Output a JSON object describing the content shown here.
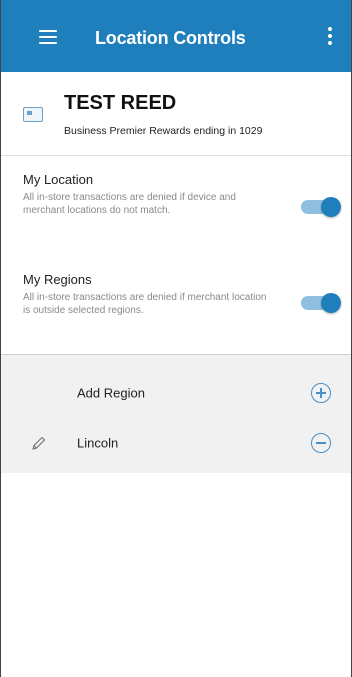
{
  "appbar": {
    "title": "Location Controls"
  },
  "card": {
    "name": "TEST REED",
    "description": "Business Premier Rewards ending in 1029"
  },
  "settings": {
    "my_location": {
      "title": "My Location",
      "description": "All in-store transactions are denied if device and merchant locations do not match.",
      "enabled": true
    },
    "my_regions": {
      "title": "My Regions",
      "description": "All in-store transactions are denied if merchant location is outside selected regions.",
      "enabled": true
    }
  },
  "regions": {
    "add_label": "Add Region",
    "items": [
      {
        "name": "Lincoln"
      }
    ]
  },
  "colors": {
    "primary": "#1f7fbd",
    "toggle_track": "#8fbfe0",
    "region_bg": "#f1f1f1",
    "muted_text": "#8a8a8a"
  },
  "icons": {
    "menu": "hamburger-menu-icon",
    "more": "more-vertical-icon",
    "card": "credit-card-icon",
    "add": "plus-circle-icon",
    "remove": "minus-circle-icon",
    "edit": "pencil-icon"
  }
}
